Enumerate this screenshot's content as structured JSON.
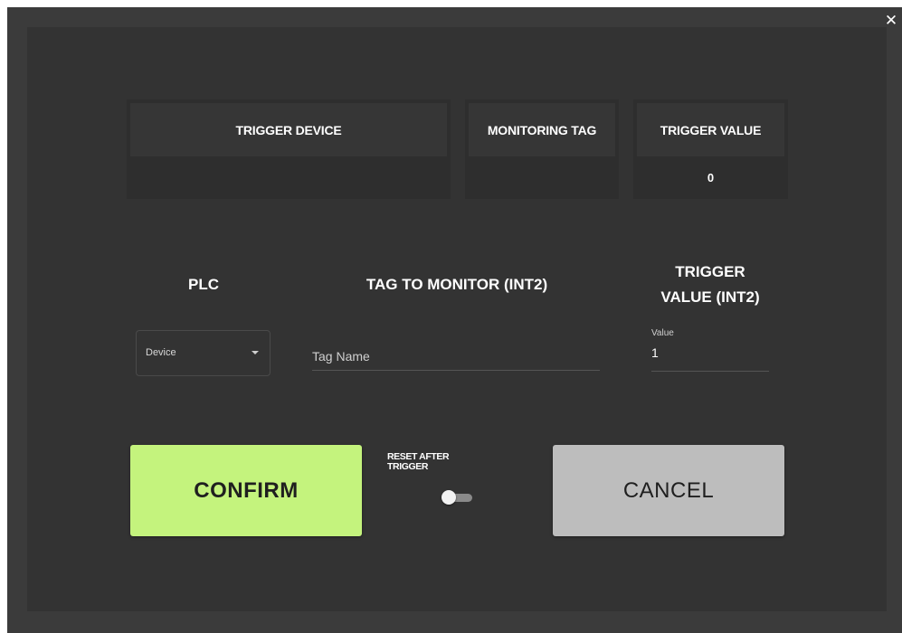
{
  "dialog": {
    "close_glyph": "✕"
  },
  "status_table": {
    "columns": [
      {
        "header": "TRIGGER DEVICE",
        "value": ""
      },
      {
        "header": "MONITORING TAG",
        "value": ""
      },
      {
        "header": "TRIGGER VALUE",
        "value": "0"
      }
    ]
  },
  "form": {
    "plc_label": "PLC",
    "tag_label": "TAG TO MONITOR (INT2)",
    "trigger_label_line1": "TRIGGER",
    "trigger_label_line2": "VALUE (INT2)",
    "device_select_value": "Device",
    "tag_input_placeholder": "Tag Name",
    "tag_input_value": "",
    "value_field_label": "Value",
    "value_field_value": "1"
  },
  "actions": {
    "confirm_label": "CONFIRM",
    "cancel_label": "CANCEL",
    "reset_label_line1": "RESET AFTER",
    "reset_label_line2": "TRIGGER",
    "reset_toggle_on": false
  },
  "colors": {
    "confirm_bg": "#c4f37d",
    "cancel_bg": "#bdbdbd",
    "dialog_bg": "#333333"
  }
}
